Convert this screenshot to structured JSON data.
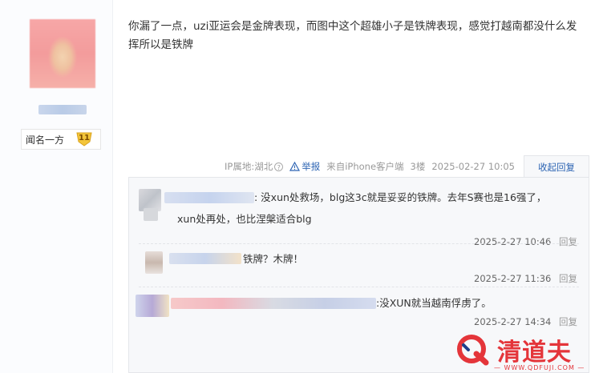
{
  "author": {
    "level_name": "闻名一方",
    "level_number": "11"
  },
  "post": {
    "content": "你漏了一点，uzi亚运会是金牌表现，而图中这个超雄小子是铁牌表现，感觉打越南都没什么发挥所以是铁牌",
    "ip_location": "IP属地:湖北",
    "report_label": "举报",
    "source": "来自iPhone客户端",
    "floor": "3楼",
    "timestamp": "2025-02-27 10:05",
    "collapse_label": "收起回复"
  },
  "replies": [
    {
      "text_line1": ": 没xun处救场，blg这3c就是妥妥的铁牌。去年S赛也是16强了，",
      "text_line2": "xun处再处，也比涅槃适合blg",
      "timestamp": "2025-2-27 10:46",
      "reply_label": "回复"
    },
    {
      "text_line1": "铁牌？木牌！",
      "timestamp": "2025-2-27 11:36",
      "reply_label": "回复"
    },
    {
      "text_line1": ":没XUN就当越南俘虏了。",
      "timestamp": "2025-2-27 14:34",
      "reply_label": "回复"
    }
  ],
  "watermark": {
    "brand": "清道夫",
    "url": "— WWW.QDFUJI.COM —"
  },
  "colors": {
    "link": "#2d64b3",
    "meta": "#999999",
    "reply_bg": "#f7f8fa",
    "brand_red": "#e4353a",
    "badge_gold": "#f3c53a"
  }
}
